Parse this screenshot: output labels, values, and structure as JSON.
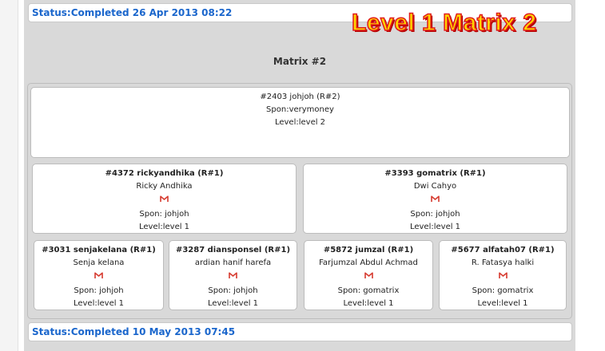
{
  "status_top": "Status:Completed 26 Apr 2013 08:22",
  "status_bottom": "Status:Completed 10 May 2013 07:45",
  "banner": "Level 1 Matrix 2",
  "matrix_title": "Matrix #2",
  "colors": {
    "status_text": "#1a66cc",
    "banner_fill": "#ffd500",
    "banner_stroke": "#e01a1a",
    "mail_icon": "#d63a2f"
  },
  "root": {
    "head": "#2403 johjoh (R#2)",
    "spon": "Spon:verymoney",
    "level": "Level:level 2"
  },
  "level2": [
    {
      "head": "#4372 rickyandhika (R#1)",
      "name": "Ricky Andhika",
      "icon": "gmail-icon",
      "spon": "Spon: johjoh",
      "level": "Level:level 1"
    },
    {
      "head": "#3393 gomatrix (R#1)",
      "name": "Dwi Cahyo",
      "icon": "gmail-icon",
      "spon": "Spon: johjoh",
      "level": "Level:level 1"
    }
  ],
  "level3": [
    {
      "head": "#3031 senjakelana (R#1)",
      "name": "Senja kelana",
      "icon": "gmail-icon",
      "spon": "Spon: johjoh",
      "level": "Level:level 1"
    },
    {
      "head": "#3287 diansponsel (R#1)",
      "name": "ardian hanif harefa",
      "icon": "gmail-icon",
      "spon": "Spon: johjoh",
      "level": "Level:level 1"
    },
    {
      "head": "#5872 jumzal (R#1)",
      "name": "Farjumzal Abdul Achmad",
      "icon": "gmail-icon",
      "spon": "Spon: gomatrix",
      "level": "Level:level 1"
    },
    {
      "head": "#5677 alfatah07 (R#1)",
      "name": "R. Fatasya halki",
      "icon": "gmail-icon",
      "spon": "Spon: gomatrix",
      "level": "Level:level 1"
    }
  ]
}
